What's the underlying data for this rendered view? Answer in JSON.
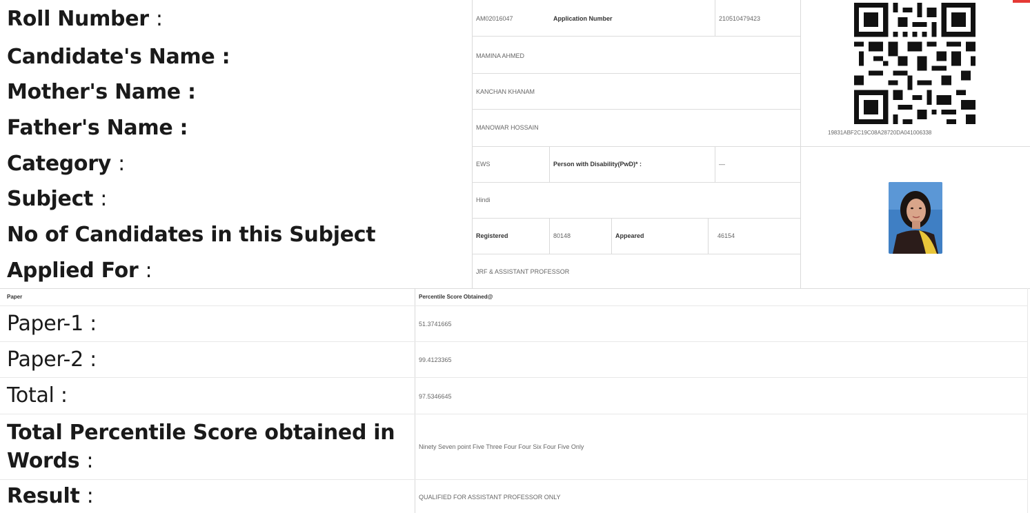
{
  "header_fields": {
    "roll_number_label": "Roll Number",
    "candidate_name_label": "Candidate's Name",
    "mother_name_label": "Mother's Name",
    "father_name_label": "Father's Name",
    "category_label": "Category",
    "subject_label": "Subject",
    "no_of_candidates_label": "No of Candidates in this Subject",
    "applied_for_label": "Applied For",
    "colon": ":"
  },
  "values": {
    "roll_number": "AM02016047",
    "application_number_label": "Application Number",
    "application_number": "210510479423",
    "candidate_name": "MAMINA AHMED",
    "mother_name": "KANCHAN KHANAM",
    "father_name": "MANOWAR HOSSAIN",
    "category": "EWS",
    "pwd_label": "Person with Disability(PwD)* :",
    "pwd_value": "—",
    "subject": "Hindi",
    "registered_label": "Registered",
    "registered_value": "80148",
    "appeared_label": "Appeared",
    "appeared_value": "46154",
    "applied_for": "JRF & ASSISTANT PROFESSOR"
  },
  "qr": {
    "code_text": "19831ABF2C19C08A28720DA041006338"
  },
  "score_table": {
    "col_paper": "Paper",
    "col_percentile": "Percentile Score Obtained@",
    "rows": [
      {
        "label": "Paper-1",
        "value": "51.3741665"
      },
      {
        "label": "Paper-2",
        "value": "99.4123365"
      },
      {
        "label": "Total",
        "value": "97.5346645"
      }
    ],
    "words_label_line1": "Total Percentile Score obtained in",
    "words_label_line2": "Words",
    "words_value": "Ninety Seven point Five Three Four Four Six Four Five Only",
    "result_label": "Result",
    "result_value": "QUALIFIED FOR ASSISTANT PROFESSOR ONLY"
  },
  "colors": {
    "accent_red": "#e53935",
    "border": "#d9d9d9"
  }
}
